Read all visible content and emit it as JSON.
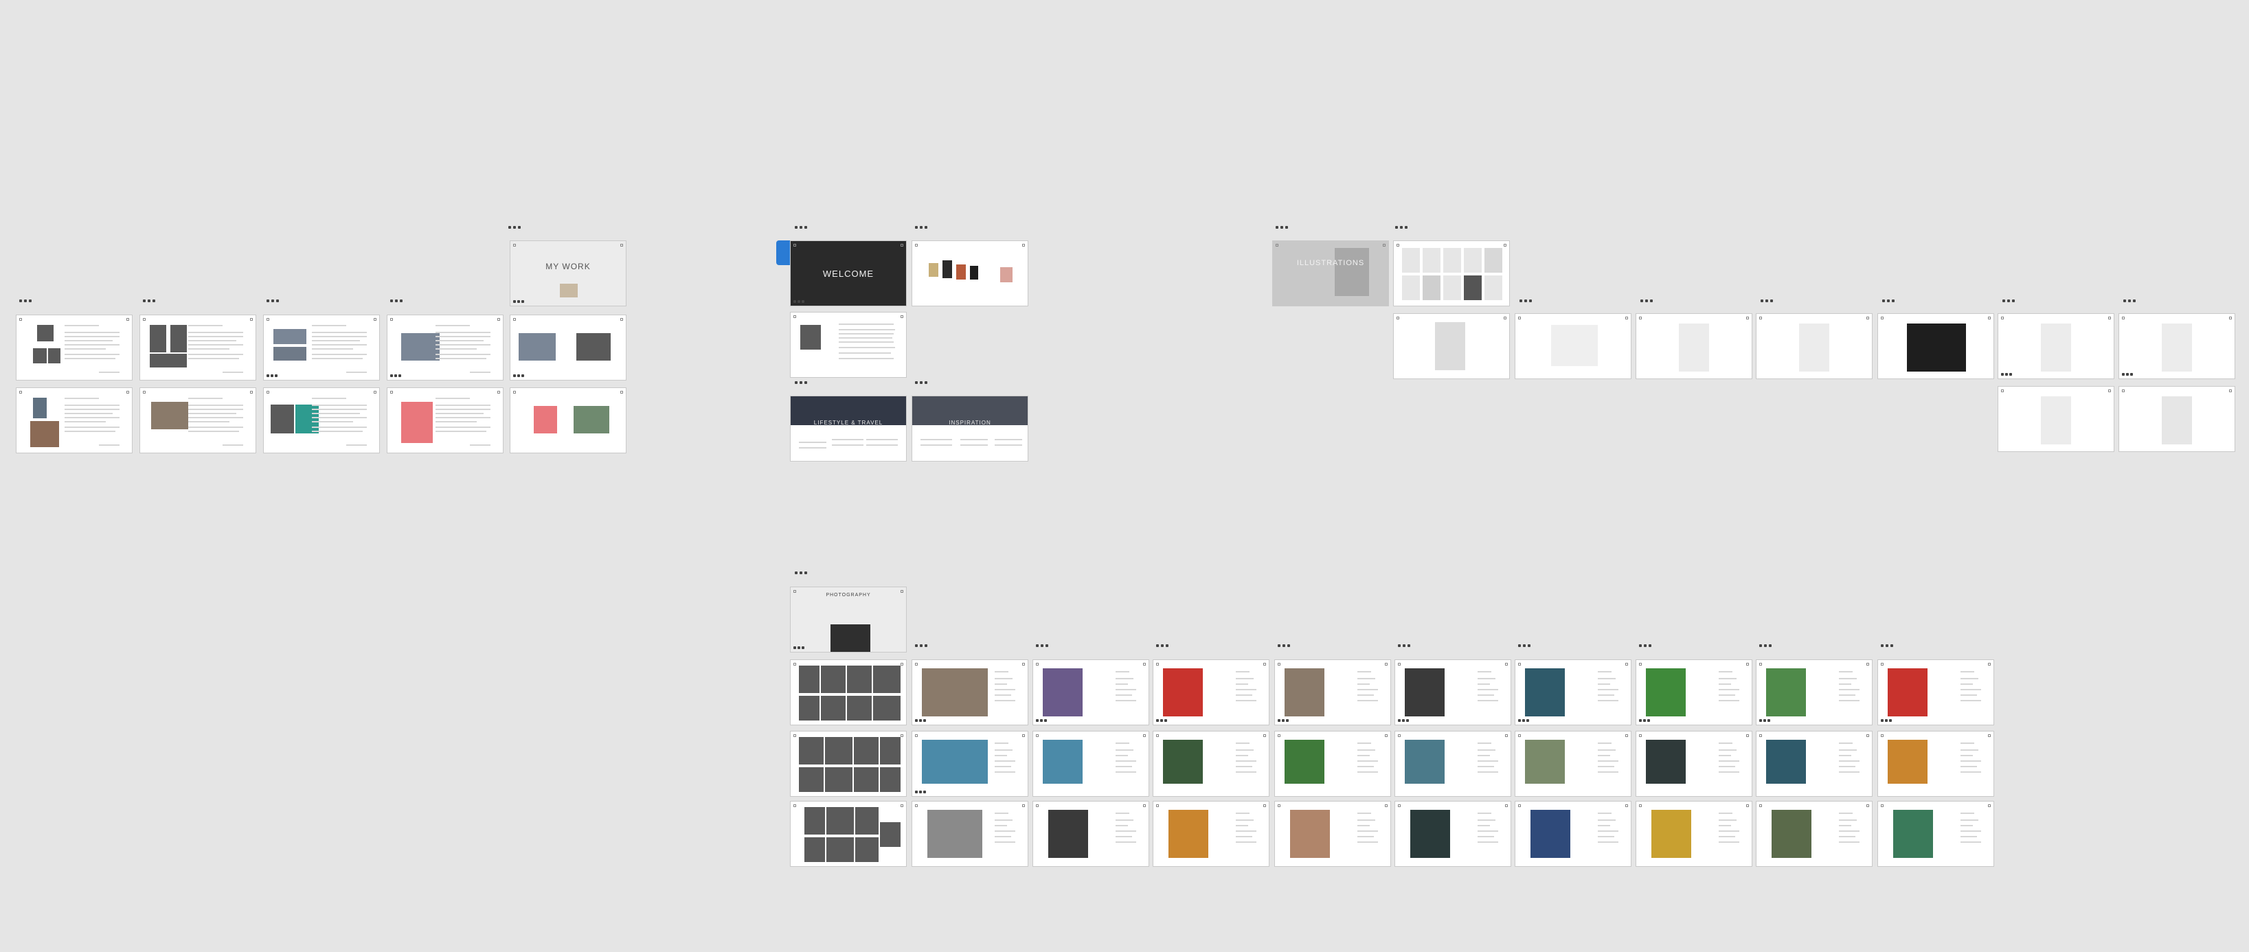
{
  "canvas": {
    "background": "#e5e5e5",
    "cover_titles": {
      "my_work": "MY WORK",
      "welcome": "WELCOME",
      "illustrations": "ILLUSTRATIONS",
      "photography": "PHOTOGRAPHY",
      "lifestyle": "LIFESTYLE & TRAVEL",
      "inspiration": "INSPIRATION"
    },
    "photo_tones": {
      "portrait": "#8a7a6a",
      "nature": "#3f7a3a",
      "water": "#4b8aa8",
      "red_shirt": "#c8332d",
      "bw": "#5a5a5a",
      "pink": "#e9777c",
      "sketch": "#dcdcdc",
      "night": "#2f2f3a",
      "warm": "#c9852e"
    },
    "selection_color": "#2a7bd4"
  }
}
